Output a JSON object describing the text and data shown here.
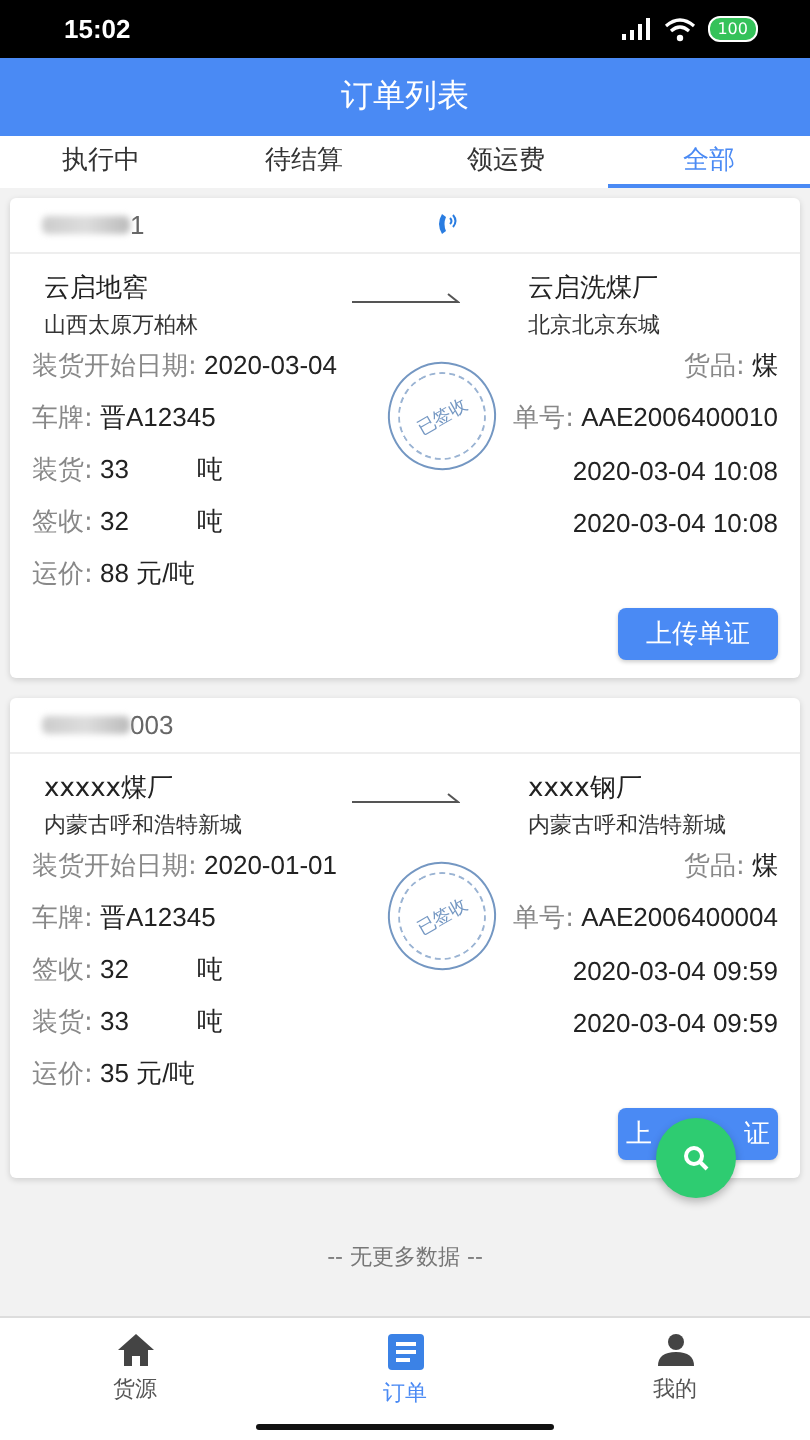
{
  "status_bar": {
    "time": "15:02",
    "battery": "100"
  },
  "header": {
    "title": "订单列表"
  },
  "tabs": [
    {
      "label": "执行中",
      "selected": false
    },
    {
      "label": "待结算",
      "selected": false
    },
    {
      "label": "领运费",
      "selected": false
    },
    {
      "label": "全部",
      "selected": true
    }
  ],
  "orders": [
    {
      "order_no_visible": "1",
      "phone": true,
      "from": {
        "name": "云启地窖",
        "address": "山西太原万柏林"
      },
      "to": {
        "name": "云启洗煤厂",
        "address": "北京北京东城"
      },
      "start_date_label": "装货开始日期:",
      "start_date": "2020-03-04",
      "goods_label": "货品:",
      "goods": "煤",
      "plate_label": "车牌:",
      "plate": "晋A12345",
      "number_label": "单号:",
      "number": "AAE2006400010",
      "stamp": "已签收",
      "weights": [
        {
          "label": "装货:",
          "value": "33",
          "unit": "吨",
          "time": "2020-03-04 10:08"
        },
        {
          "label": "签收:",
          "value": "32",
          "unit": "吨",
          "time": "2020-03-04 10:08"
        }
      ],
      "price_label": "运价:",
      "price": "88 元/吨",
      "button_text_visible": [
        "上传单证"
      ]
    },
    {
      "order_no_visible": "003",
      "phone": false,
      "from": {
        "name": "xxxxx煤厂",
        "address": "内蒙古呼和浩特新城"
      },
      "to": {
        "name": "xxxx钢厂",
        "address": "内蒙古呼和浩特新城"
      },
      "start_date_label": "装货开始日期:",
      "start_date": "2020-01-01",
      "goods_label": "货品:",
      "goods": "煤",
      "plate_label": "车牌:",
      "plate": "晋A12345",
      "number_label": "单号:",
      "number": "AAE2006400004",
      "stamp": "已签收",
      "weights": [
        {
          "label": "签收:",
          "value": "32",
          "unit": "吨",
          "time": "2020-03-04 09:59"
        },
        {
          "label": "装货:",
          "value": "33",
          "unit": "吨",
          "time": "2020-03-04 09:59"
        }
      ],
      "price_label": "运价:",
      "price": "35 元/吨",
      "button_text_visible": [
        "上",
        "证"
      ]
    }
  ],
  "end_note": "-- 无更多数据 --",
  "bottom_nav": [
    {
      "kind": "home",
      "label": "货源",
      "selected": false
    },
    {
      "kind": "orders",
      "label": "订单",
      "selected": true
    },
    {
      "kind": "profile",
      "label": "我的",
      "selected": false
    }
  ]
}
